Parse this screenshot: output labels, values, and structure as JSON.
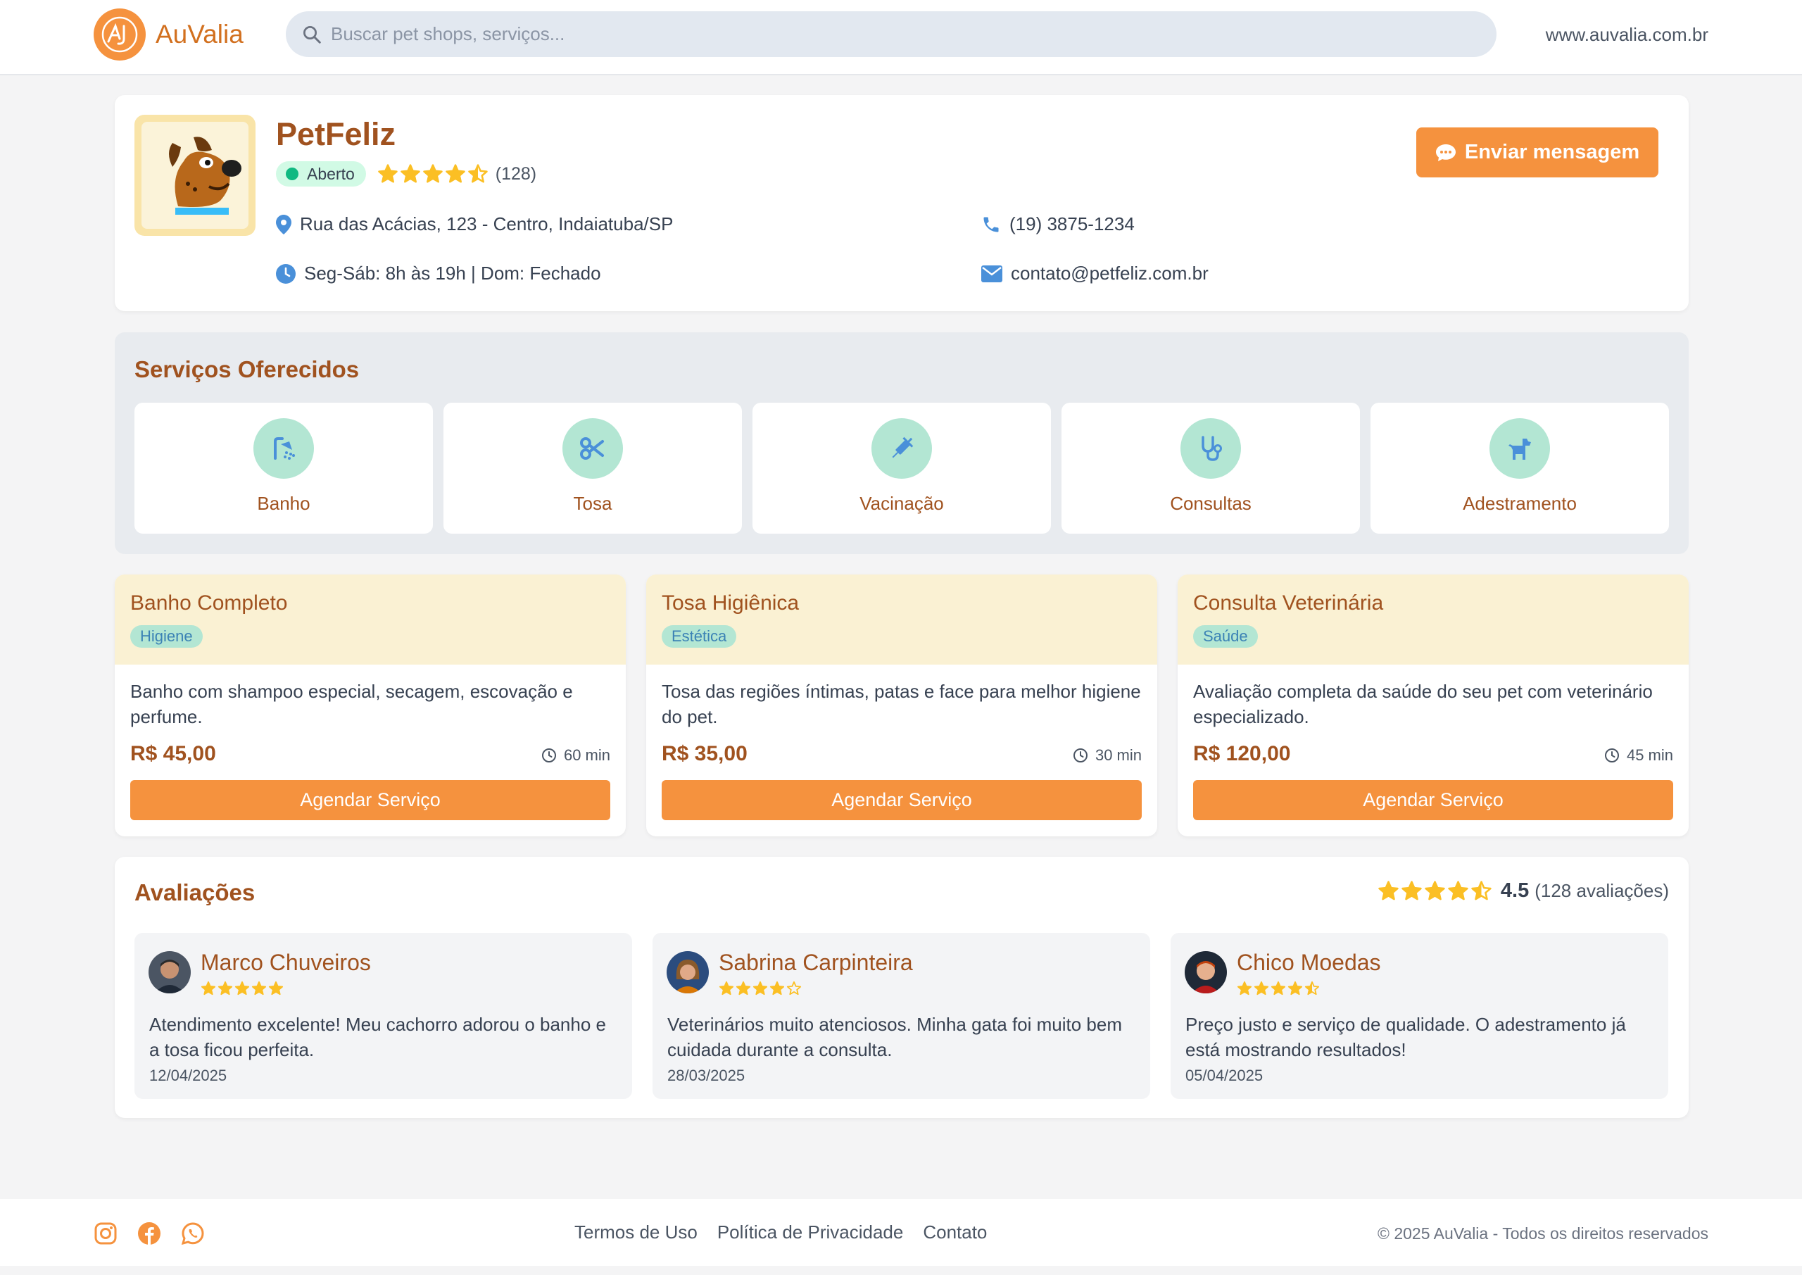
{
  "header": {
    "logo_text": "AuValia",
    "search_placeholder": "Buscar pet shops, serviços...",
    "site_url": "www.auvalia.com.br"
  },
  "profile": {
    "name": "PetFeliz",
    "status": "Aberto",
    "rating": 4.5,
    "rating_count": "(128)",
    "address": "Rua das Acácias, 123 - Centro, Indaiatuba/SP",
    "hours": "Seg-Sáb: 8h às 19h | Dom: Fechado",
    "phone": "(19) 3875-1234",
    "email": "contato@petfeliz.com.br",
    "message_button": "Enviar mensagem"
  },
  "services": {
    "title": "Serviços Oferecidos",
    "items": [
      {
        "label": "Banho",
        "icon": "shower-icon"
      },
      {
        "label": "Tosa",
        "icon": "scissors-icon"
      },
      {
        "label": "Vacinação",
        "icon": "syringe-icon"
      },
      {
        "label": "Consultas",
        "icon": "stethoscope-icon"
      },
      {
        "label": "Adestramento",
        "icon": "dog-icon"
      }
    ]
  },
  "offers": [
    {
      "title": "Banho Completo",
      "tag": "Higiene",
      "description": "Banho com shampoo especial, secagem, escovação e perfume.",
      "price": "R$ 45,00",
      "duration": "60 min",
      "button": "Agendar Serviço"
    },
    {
      "title": "Tosa Higiênica",
      "tag": "Estética",
      "description": "Tosa das regiões íntimas, patas e face para melhor higiene do pet.",
      "price": "R$ 35,00",
      "duration": "30 min",
      "button": "Agendar Serviço"
    },
    {
      "title": "Consulta Veterinária",
      "tag": "Saúde",
      "description": "Avaliação completa da saúde do seu pet com veterinário especializado.",
      "price": "R$ 120,00",
      "duration": "45 min",
      "button": "Agendar Serviço"
    }
  ],
  "reviews": {
    "title": "Avaliações",
    "average": "4.5",
    "total": "(128 avaliações)",
    "average_stars": 4.5,
    "items": [
      {
        "name": "Marco Chuveiros",
        "stars": 5,
        "text": "Atendimento excelente! Meu cachorro adorou o banho e a tosa ficou perfeita.",
        "date": "12/04/2025"
      },
      {
        "name": "Sabrina Carpinteira",
        "stars": 4,
        "text": "Veterinários muito atenciosos. Minha gata foi muito bem cuidada durante a consulta.",
        "date": "28/03/2025"
      },
      {
        "name": "Chico Moedas",
        "stars": 4.5,
        "text": "Preço justo e serviço de qualidade. O adestramento já está mostrando resultados!",
        "date": "05/04/2025"
      }
    ]
  },
  "footer": {
    "links": [
      "Termos de Uso",
      "Política de Privacidade",
      "Contato"
    ],
    "copyright": "© 2025 AuValia - Todos os direitos reservados",
    "social_icons": [
      "instagram-icon",
      "facebook-icon",
      "whatsapp-icon"
    ]
  },
  "colors": {
    "accent": "#f5923e",
    "brand_brown": "#a0521f",
    "star": "#fbbf24",
    "icon_blue": "#4a90d9",
    "mint": "#b3e6d3"
  }
}
